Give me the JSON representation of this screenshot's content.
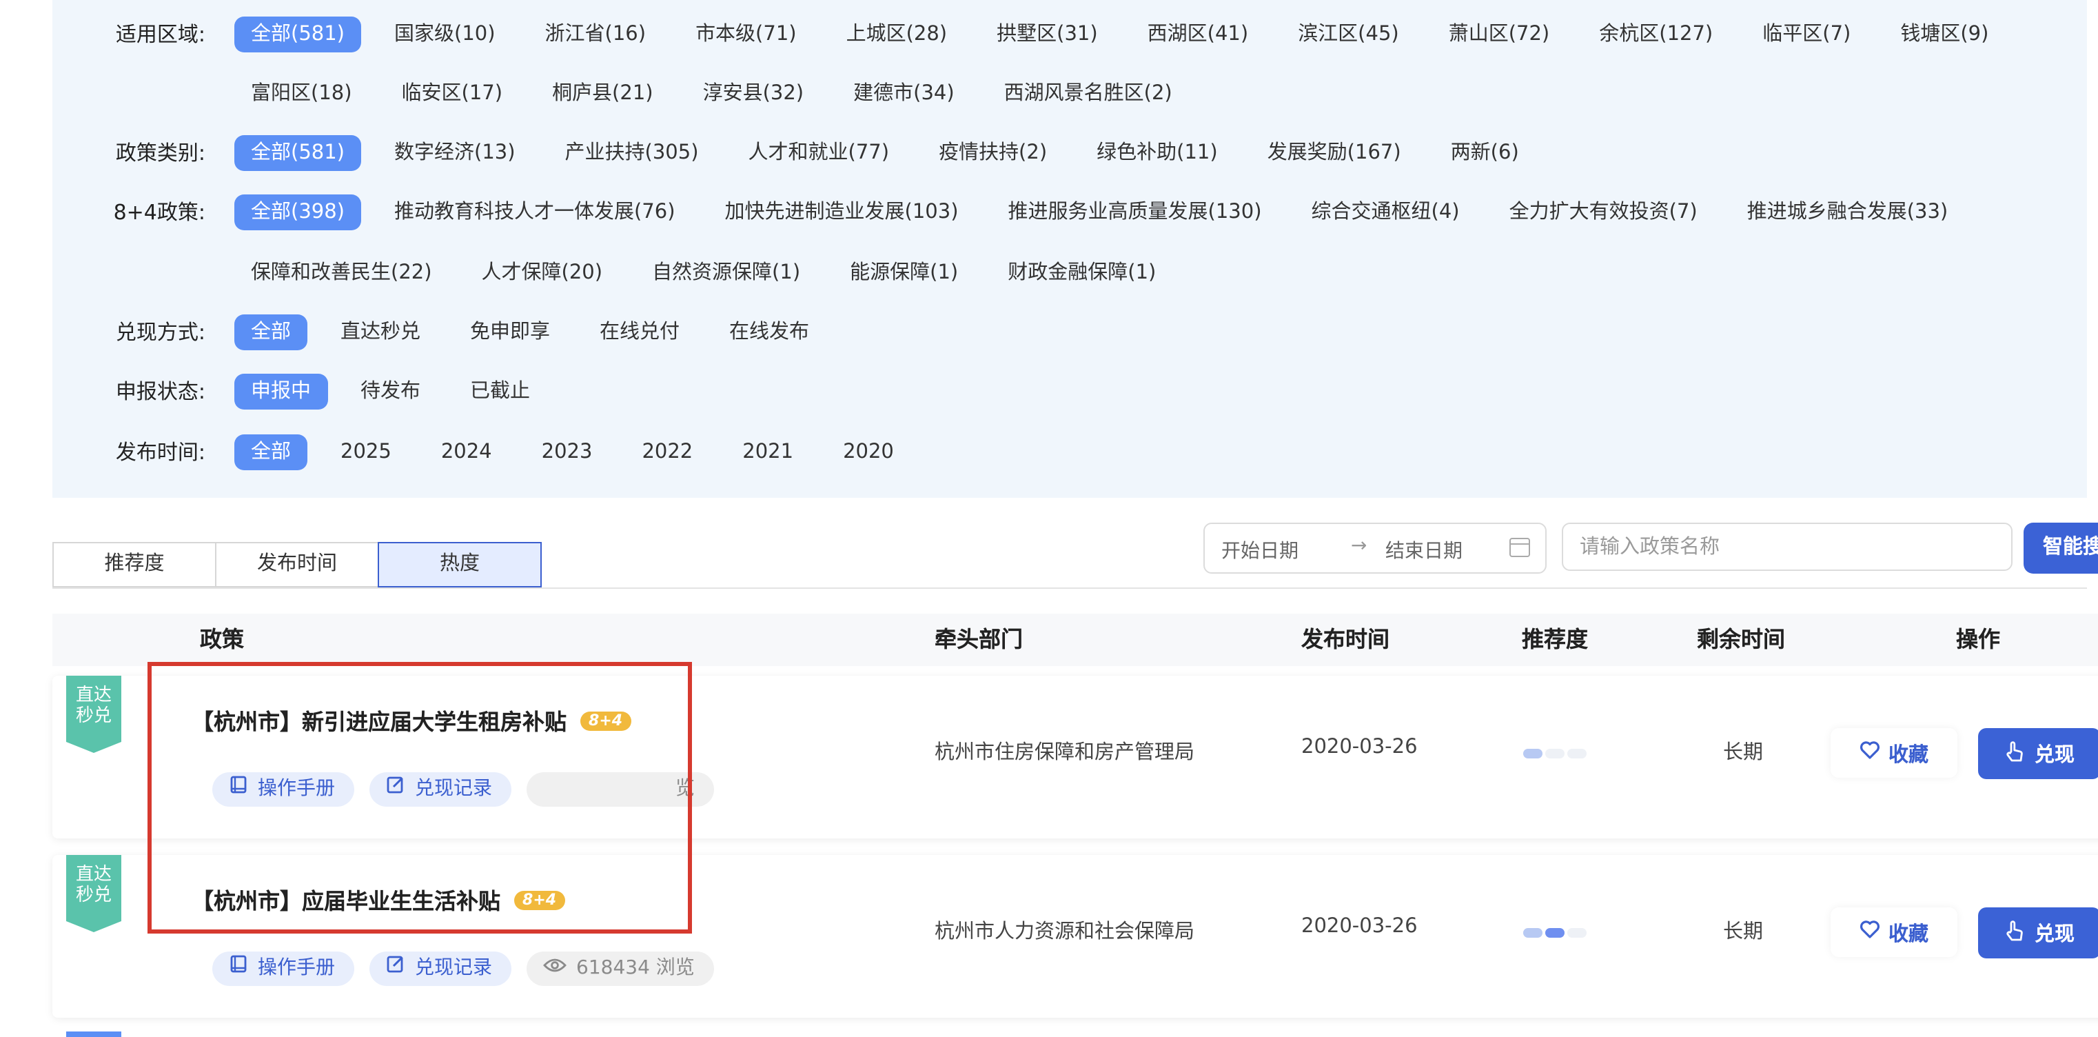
{
  "filters": [
    {
      "label": "适用区域:",
      "rows": [
        [
          "全部(581)",
          "国家级(10)",
          "浙江省(16)",
          "市本级(71)",
          "上城区(28)",
          "拱墅区(31)",
          "西湖区(41)",
          "滨江区(45)",
          "萧山区(72)",
          "余杭区(127)",
          "临平区(7)",
          "钱塘区(9)"
        ],
        [
          "富阳区(18)",
          "临安区(17)",
          "桐庐县(21)",
          "淳安县(32)",
          "建德市(34)",
          "西湖风景名胜区(2)"
        ]
      ],
      "selected": "全部(581)"
    },
    {
      "label": "政策类别:",
      "rows": [
        [
          "全部(581)",
          "数字经济(13)",
          "产业扶持(305)",
          "人才和就业(77)",
          "疫情扶持(2)",
          "绿色补助(11)",
          "发展奖励(167)",
          "两新(6)"
        ]
      ],
      "selected": "全部(581)"
    },
    {
      "label": "8+4政策:",
      "rows": [
        [
          "全部(398)",
          "推动教育科技人才一体发展(76)",
          "加快先进制造业发展(103)",
          "推进服务业高质量发展(130)",
          "综合交通枢纽(4)",
          "全力扩大有效投资(7)",
          "推进城乡融合发展(33)"
        ],
        [
          "保障和改善民生(22)",
          "人才保障(20)",
          "自然资源保障(1)",
          "能源保障(1)",
          "财政金融保障(1)"
        ]
      ],
      "selected": "全部(398)"
    },
    {
      "label": "兑现方式:",
      "rows": [
        [
          "全部",
          "直达秒兑",
          "免申即享",
          "在线兑付",
          "在线发布"
        ]
      ],
      "selected": "全部"
    },
    {
      "label": "申报状态:",
      "rows": [
        [
          "申报中",
          "待发布",
          "已截止"
        ]
      ],
      "selected": "申报中"
    },
    {
      "label": "发布时间:",
      "rows": [
        [
          "全部",
          "2025",
          "2024",
          "2023",
          "2022",
          "2021",
          "2020"
        ]
      ],
      "selected": "全部"
    }
  ],
  "sort_tabs": {
    "items": [
      "推荐度",
      "发布时间",
      "热度"
    ],
    "active": "热度"
  },
  "date_range": {
    "start_placeholder": "开始日期",
    "separator": "→",
    "end_placeholder": "结束日期"
  },
  "search": {
    "placeholder": "请输入政策名称",
    "button": "智能搜索"
  },
  "table": {
    "headers": {
      "policy": "政策",
      "dept": "牵头部门",
      "date": "发布时间",
      "recommend": "推荐度",
      "remaining": "剩余时间",
      "ops": "操作"
    },
    "rows": [
      {
        "ribbon": "直达\n秒兑",
        "title": "【杭州市】新引进应届大学生租房补贴",
        "badge": "8+4",
        "manual": "操作手册",
        "record": "兑现记录",
        "views": "",
        "views_suffix": "览",
        "dept": "杭州市住房保障和房产管理局",
        "date": "2020-03-26",
        "recommend_level": 1,
        "remaining": "长期",
        "fav": "收藏",
        "redeem": "兑现"
      },
      {
        "ribbon": "直达\n秒兑",
        "title": "【杭州市】应届毕业生生活补贴",
        "badge": "8+4",
        "manual": "操作手册",
        "record": "兑现记录",
        "views": "618434 浏览",
        "views_suffix": "",
        "dept": "杭州市人力资源和社会保障局",
        "date": "2020-03-26",
        "recommend_level": 2,
        "remaining": "长期",
        "fav": "收藏",
        "redeem": "兑现"
      }
    ]
  },
  "colors": {
    "accent": "#5b8ff5",
    "primary_button": "#3b62d6",
    "ribbon": "#5ac3ab",
    "badge": "#f1b93c",
    "highlight": "#d63a2f",
    "panel_bg": "#f0f6fc"
  }
}
